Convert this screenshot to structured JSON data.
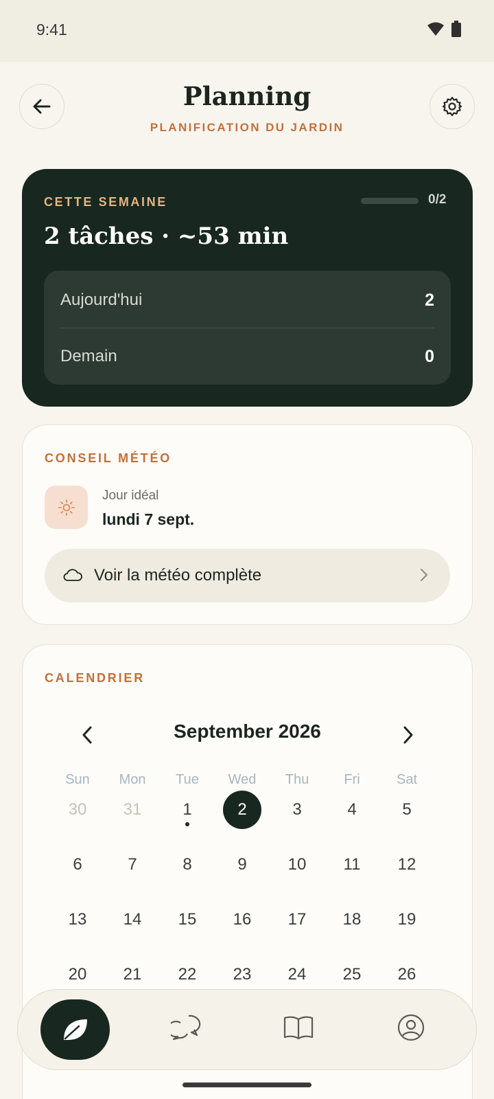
{
  "status_bar": {
    "time": "9:41"
  },
  "header": {
    "title": "Planning",
    "subtitle": "PLANIFICATION DU JARDIN"
  },
  "week": {
    "label": "CETTE SEMAINE",
    "progress_text": "0/2",
    "progress_fraction": 0,
    "summary": "2 tâches · ~53 min",
    "rows": [
      {
        "label": "Aujourd'hui",
        "value": "2"
      },
      {
        "label": "Demain",
        "value": "0"
      }
    ]
  },
  "weather": {
    "label": "CONSEIL MÉTÉO",
    "icon": "sun-icon",
    "ideal_label": "Jour idéal",
    "ideal_date": "lundi 7 sept.",
    "button_label": "Voir la météo complète"
  },
  "calendar": {
    "label": "CALENDRIER",
    "month": "September 2026",
    "weekdays": [
      "Sun",
      "Mon",
      "Tue",
      "Wed",
      "Thu",
      "Fri",
      "Sat"
    ],
    "weeks": [
      [
        "30",
        "31",
        "1",
        "2",
        "3",
        "4",
        "5"
      ],
      [
        "6",
        "7",
        "8",
        "9",
        "10",
        "11",
        "12"
      ],
      [
        "13",
        "14",
        "15",
        "16",
        "17",
        "18",
        "19"
      ],
      [
        "20",
        "21",
        "22",
        "23",
        "24",
        "25",
        "26"
      ]
    ],
    "muted_days": [
      "30",
      "31"
    ],
    "selected_day": "2",
    "dotted_days": [
      "1"
    ]
  },
  "bottom_nav": {
    "items": [
      "leaf-icon",
      "chat-icon",
      "book-icon",
      "profile-icon"
    ],
    "active": "leaf-icon"
  },
  "colors": {
    "accent": "#c0703c",
    "dark": "#182820",
    "gold": "#e3b584",
    "background": "#f8f5ee"
  }
}
